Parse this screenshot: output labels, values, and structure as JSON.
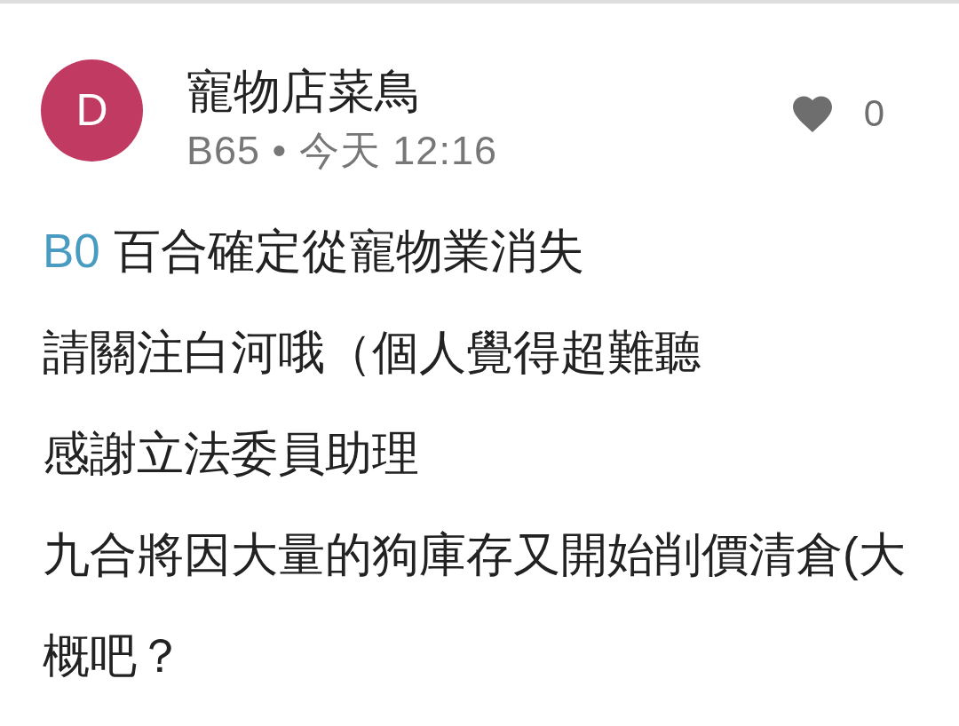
{
  "comment": {
    "avatar": {
      "letter": "D"
    },
    "author": "寵物店菜鳥",
    "meta": "B65 • 今天 12:16",
    "likes": "0",
    "lines": [
      {
        "reply_to": "B0",
        "text": "百合確定從寵物業消失"
      },
      {
        "text": "請關注白河哦（個人覺得超難聽"
      },
      {
        "text": "感謝立法委員助理"
      },
      {
        "text": "九合將因大量的狗庫存又開始削價清倉(大概吧？"
      }
    ]
  }
}
